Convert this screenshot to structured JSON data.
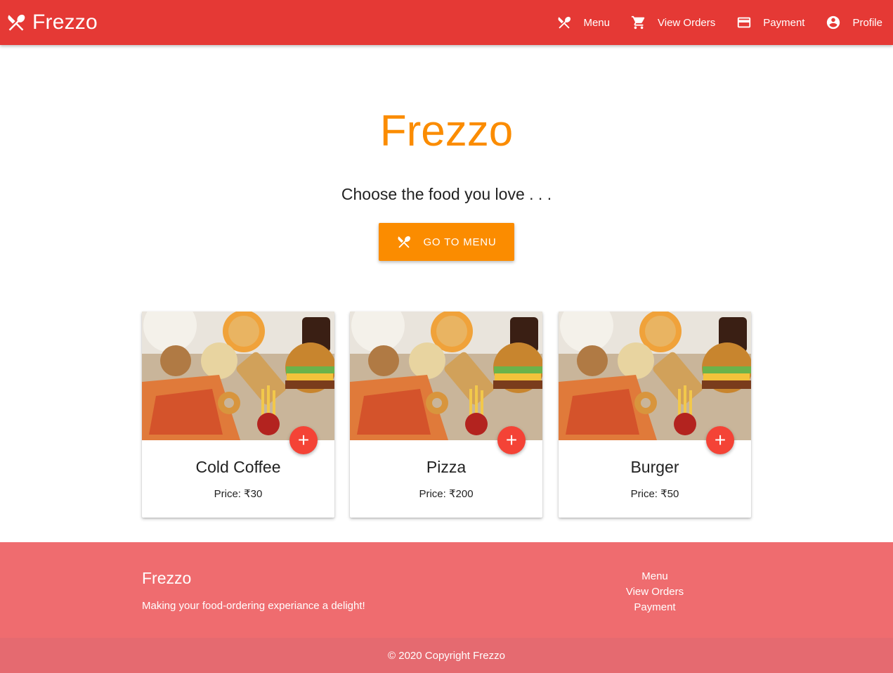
{
  "navbar": {
    "brand": "Frezzo",
    "brand_icon": "fork-knife-icon",
    "links": [
      {
        "label": "Menu",
        "icon": "fork-knife-icon"
      },
      {
        "label": "View Orders",
        "icon": "cart-icon"
      },
      {
        "label": "Payment",
        "icon": "credit-card-icon"
      },
      {
        "label": "Profile",
        "icon": "account-circle-icon"
      }
    ]
  },
  "hero": {
    "title": "Frezzo",
    "subtitle": "Choose the food you love . . .",
    "cta_label": "GO TO MENU",
    "cta_icon": "fork-knife-icon"
  },
  "cards": [
    {
      "title": "Cold Coffee",
      "price": "Price: ₹30",
      "add_label": "+"
    },
    {
      "title": "Pizza",
      "price": "Price: ₹200",
      "add_label": "+"
    },
    {
      "title": "Burger",
      "price": "Price: ₹50",
      "add_label": "+"
    }
  ],
  "footer": {
    "brand": "Frezzo",
    "tagline": "Making your food-ordering experiance a delight!",
    "links": [
      "Menu",
      "View Orders",
      "Payment"
    ],
    "copyright": "© 2020 Copyright Frezzo"
  },
  "colors": {
    "navbar": "#e53935",
    "accent": "#fb8c00",
    "fab": "#f44336",
    "footer": "#ef6c6f",
    "footer_bottom": "#e56a70"
  }
}
